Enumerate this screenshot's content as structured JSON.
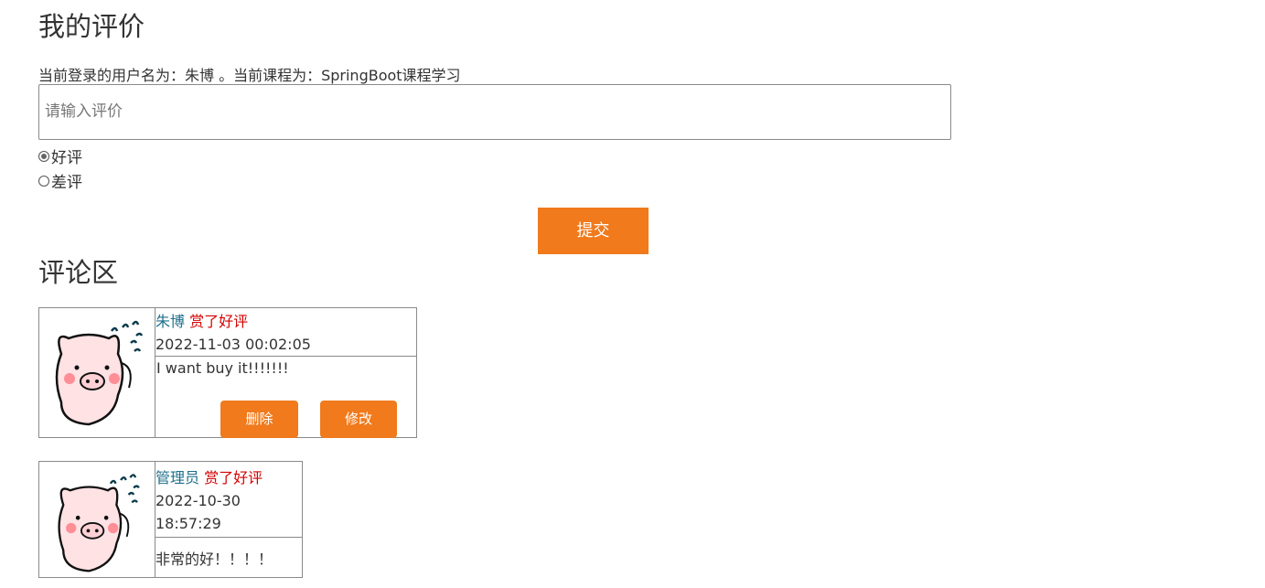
{
  "page": {
    "title": "我的评价",
    "user_line": "当前登录的用户名为：朱博 。当前课程为：SpringBoot课程学习"
  },
  "form": {
    "placeholder": "请输入评价",
    "options": [
      {
        "label": "好评",
        "checked": true
      },
      {
        "label": "差评",
        "checked": false
      }
    ],
    "submit_label": "提交"
  },
  "comments_section": {
    "title": "评论区",
    "items": [
      {
        "user": "朱博",
        "rating": "赏了好评",
        "time": "2022-11-03 00:02:05",
        "content": "I want buy it!!!!!!!",
        "delete_label": "删除",
        "edit_label": "修改"
      },
      {
        "user": "管理员",
        "rating": "赏了好评",
        "time": "2022-10-30 18:57:29",
        "content": "非常的好！！！！"
      }
    ]
  },
  "colors": {
    "accent": "#f07a1c",
    "username": "#1f6f8b",
    "rating": "#d40000"
  },
  "icons": [
    "pig-avatar-icon"
  ]
}
